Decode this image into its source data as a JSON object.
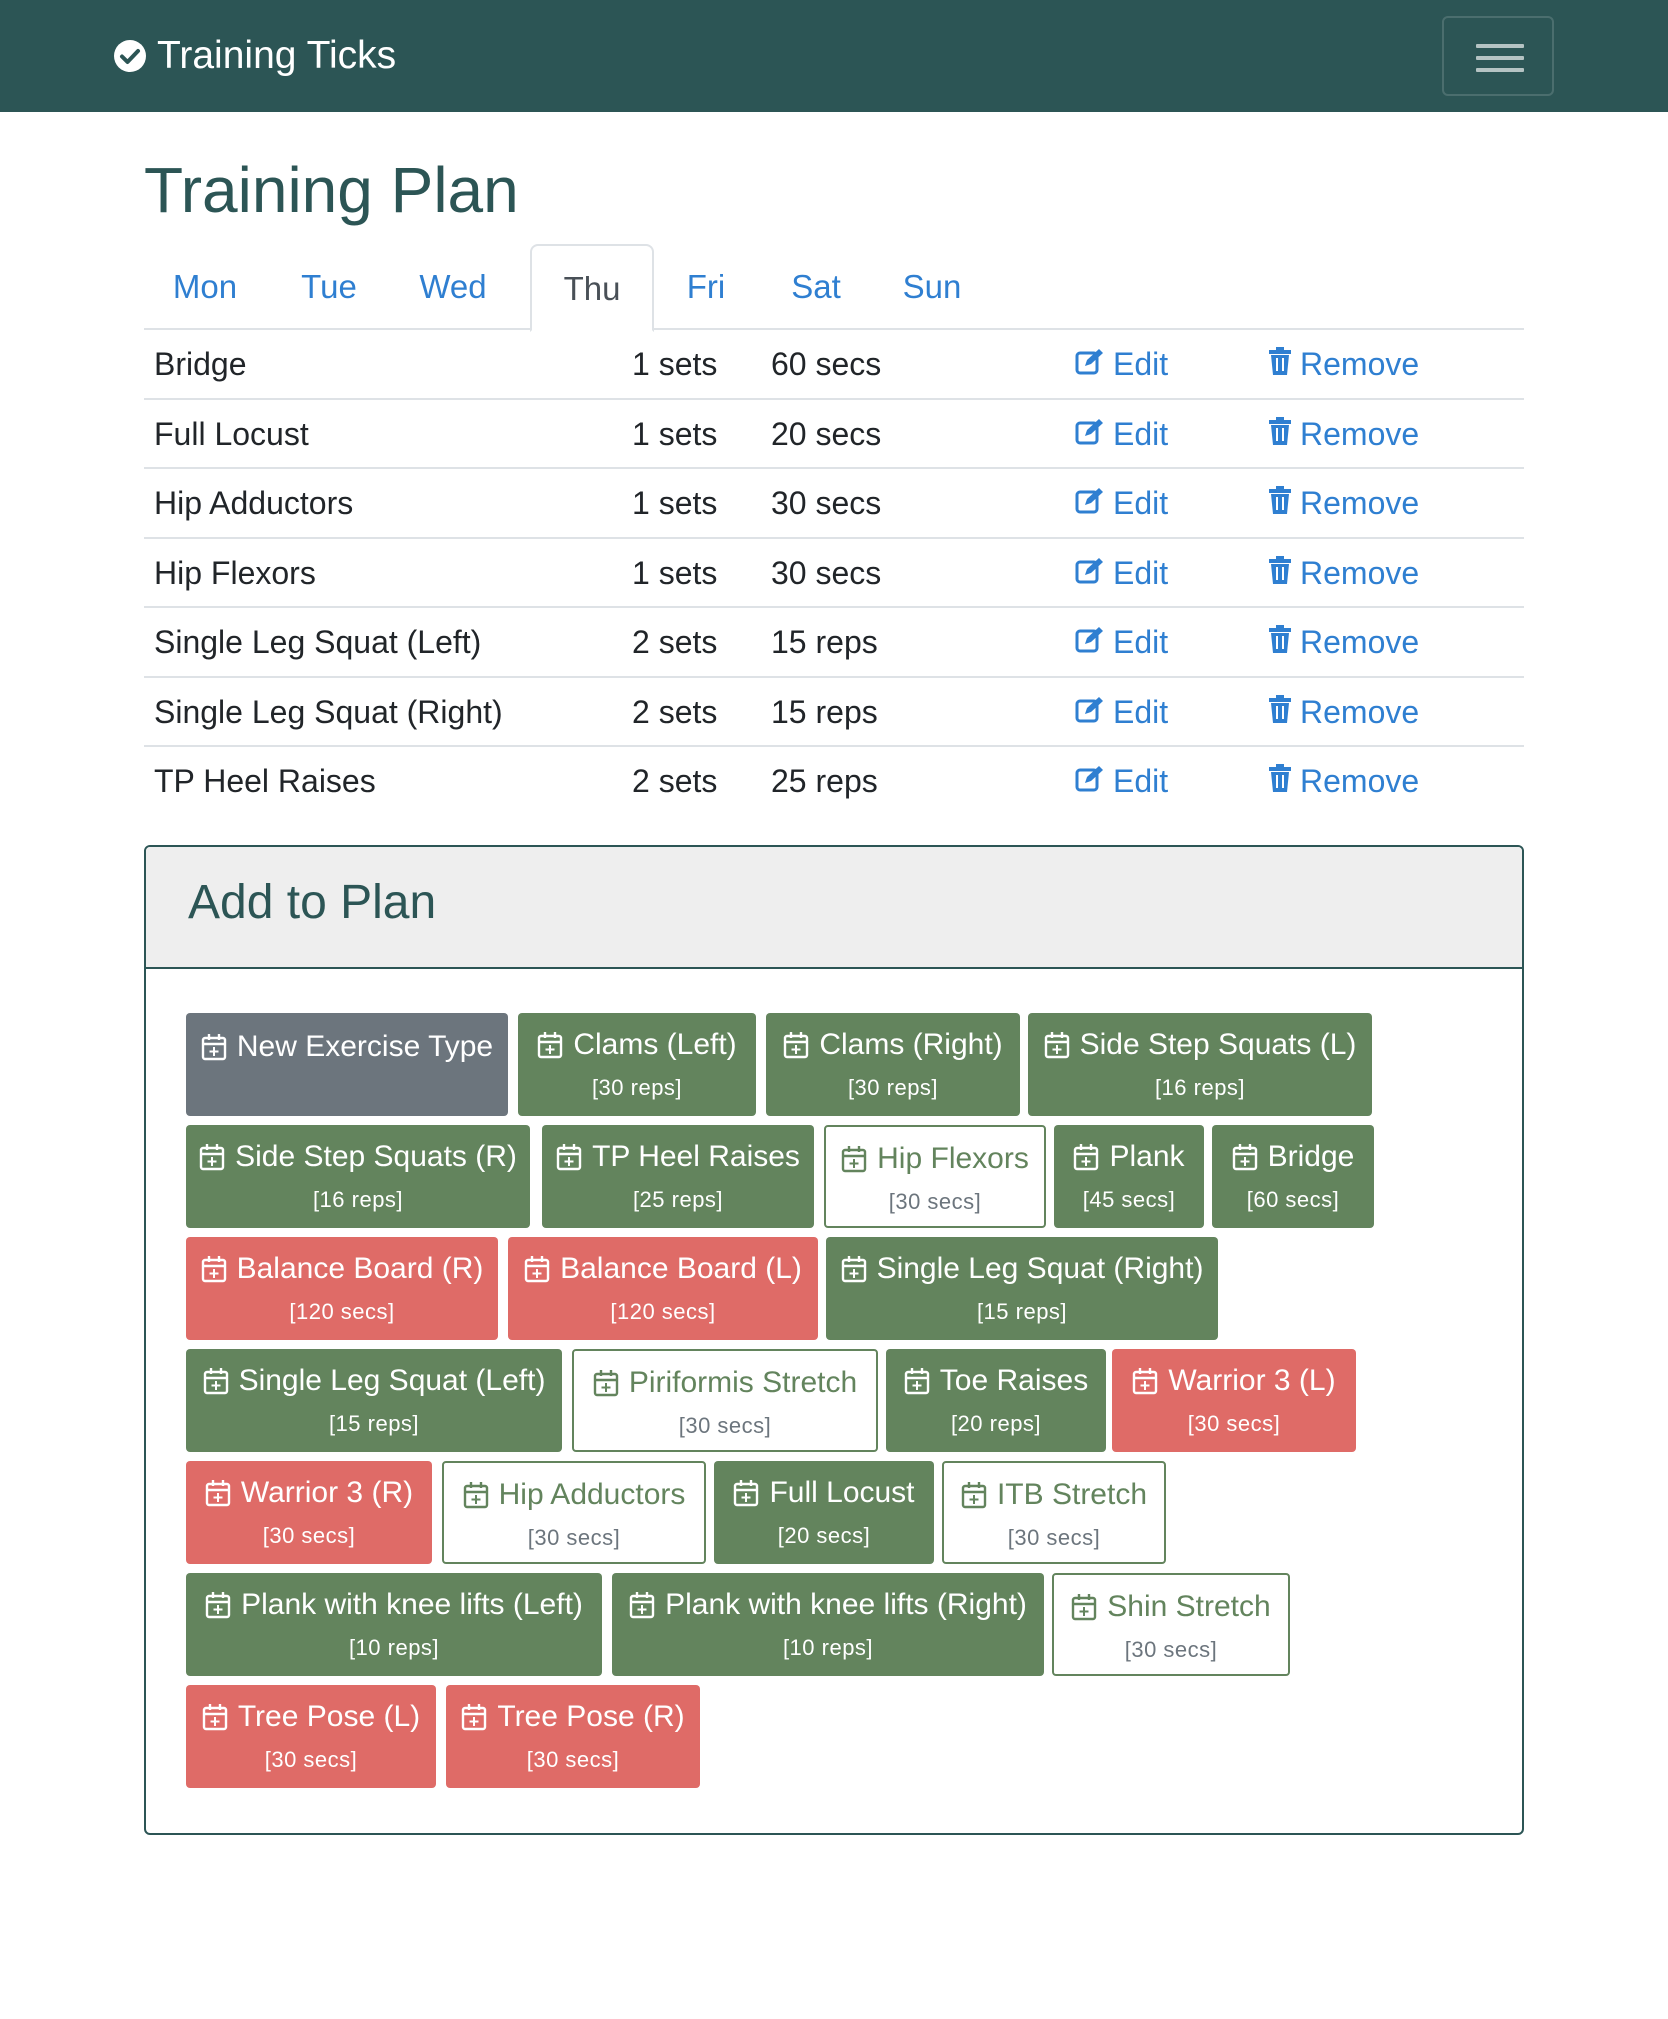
{
  "app": {
    "brand": "Training Ticks"
  },
  "page": {
    "title": "Training Plan"
  },
  "tabs": [
    {
      "label": "Mon"
    },
    {
      "label": "Tue"
    },
    {
      "label": "Wed"
    },
    {
      "label": "Thu",
      "active": true
    },
    {
      "label": "Fri"
    },
    {
      "label": "Sat"
    },
    {
      "label": "Sun"
    }
  ],
  "plan": {
    "edit_label": "Edit",
    "remove_label": "Remove",
    "rows": [
      {
        "name": "Bridge",
        "sets": "1 sets",
        "duration": "60 secs"
      },
      {
        "name": "Full Locust",
        "sets": "1 sets",
        "duration": "20 secs"
      },
      {
        "name": "Hip Adductors",
        "sets": "1 sets",
        "duration": "30 secs"
      },
      {
        "name": "Hip Flexors",
        "sets": "1 sets",
        "duration": "30 secs"
      },
      {
        "name": "Single Leg Squat (Left)",
        "sets": "2 sets",
        "duration": "15 reps"
      },
      {
        "name": "Single Leg Squat (Right)",
        "sets": "2 sets",
        "duration": "15 reps"
      },
      {
        "name": "TP Heel Raises",
        "sets": "2 sets",
        "duration": "25 reps"
      }
    ]
  },
  "add_card": {
    "title": "Add to Plan",
    "exercises": [
      {
        "label": "New Exercise Type",
        "detail": "",
        "style": "gray"
      },
      {
        "label": "Clams (Left)",
        "detail": "[30 reps]",
        "style": "green"
      },
      {
        "label": "Clams (Right)",
        "detail": "[30 reps]",
        "style": "green"
      },
      {
        "label": "Side Step Squats (L)",
        "detail": "[16 reps]",
        "style": "green"
      },
      {
        "label": "Side Step Squats (R)",
        "detail": "[16 reps]",
        "style": "green"
      },
      {
        "label": "TP Heel Raises",
        "detail": "[25 reps]",
        "style": "green"
      },
      {
        "label": "Hip Flexors",
        "detail": "[30 secs]",
        "style": "outline"
      },
      {
        "label": "Plank",
        "detail": "[45 secs]",
        "style": "green"
      },
      {
        "label": "Bridge",
        "detail": "[60 secs]",
        "style": "green"
      },
      {
        "label": "Balance Board (R)",
        "detail": "[120 secs]",
        "style": "red"
      },
      {
        "label": "Balance Board (L)",
        "detail": "[120 secs]",
        "style": "red"
      },
      {
        "label": "Single Leg Squat (Right)",
        "detail": "[15 reps]",
        "style": "green"
      },
      {
        "label": "Single Leg Squat (Left)",
        "detail": "[15 reps]",
        "style": "green"
      },
      {
        "label": "Piriformis Stretch",
        "detail": "[30 secs]",
        "style": "outline"
      },
      {
        "label": "Toe Raises",
        "detail": "[20 reps]",
        "style": "green"
      },
      {
        "label": "Warrior 3 (L)",
        "detail": "[30 secs]",
        "style": "red"
      },
      {
        "label": "Warrior 3 (R)",
        "detail": "[30 secs]",
        "style": "red"
      },
      {
        "label": "Hip Adductors",
        "detail": "[30 secs]",
        "style": "outline"
      },
      {
        "label": "Full Locust",
        "detail": "[20 secs]",
        "style": "green"
      },
      {
        "label": "ITB Stretch",
        "detail": "[30 secs]",
        "style": "outline"
      },
      {
        "label": "Plank with knee lifts (Left)",
        "detail": "[10 reps]",
        "style": "green"
      },
      {
        "label": "Plank with knee lifts (Right)",
        "detail": "[10 reps]",
        "style": "green"
      },
      {
        "label": "Shin Stretch",
        "detail": "[30 secs]",
        "style": "outline"
      },
      {
        "label": "Tree Pose (L)",
        "detail": "[30 secs]",
        "style": "red"
      },
      {
        "label": "Tree Pose (R)",
        "detail": "[30 secs]",
        "style": "red"
      }
    ]
  },
  "colors": {
    "navbar": "#2c5555",
    "link": "#2f7fd1",
    "green": "#63845d",
    "red": "#df6b67",
    "gray": "#6c757d"
  },
  "icons": {
    "brand": "check-circle-icon",
    "menu": "hamburger-menu-icon",
    "edit": "edit-icon",
    "remove": "trash-icon",
    "add": "calendar-plus-icon"
  }
}
